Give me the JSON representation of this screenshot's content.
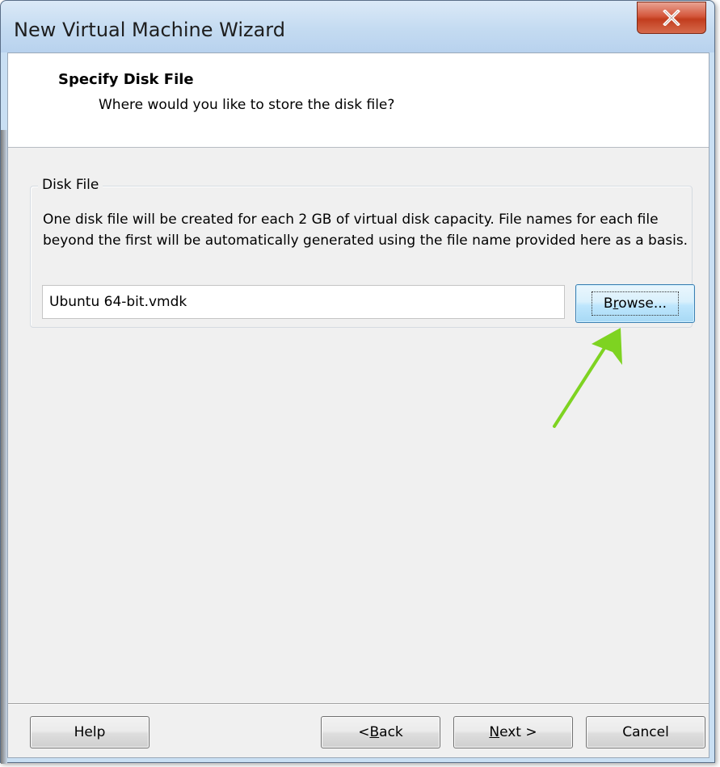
{
  "window": {
    "title": "New Virtual Machine Wizard",
    "close_icon": "close-x-icon"
  },
  "header": {
    "title": "Specify Disk File",
    "subtitle": "Where would you like to store the disk file?"
  },
  "disk_file_group": {
    "legend": "Disk File",
    "description": "One disk file will be created for each 2 GB of virtual disk capacity. File names for each file beyond the first will be automatically generated using the file name provided here as a basis.",
    "file_name_value": "Ubuntu 64-bit.vmdk",
    "browse_label": {
      "pre": "B",
      "underlined": "r",
      "post": "owse..."
    }
  },
  "annotation": {
    "arrow_icon": "green-arrow-icon",
    "arrow_color": "#7ed321"
  },
  "footer": {
    "help_label": "Help",
    "back_label": {
      "pre": "< ",
      "underlined": "B",
      "post": "ack"
    },
    "next_label": {
      "pre": "",
      "underlined": "N",
      "post": "ext >"
    },
    "cancel_label": "Cancel"
  },
  "colors": {
    "title_bar": "#c4dbf1",
    "close_button": "#c23d1e",
    "dialog_bg": "#f0f0f0",
    "focused_button": "#bee6fd"
  }
}
